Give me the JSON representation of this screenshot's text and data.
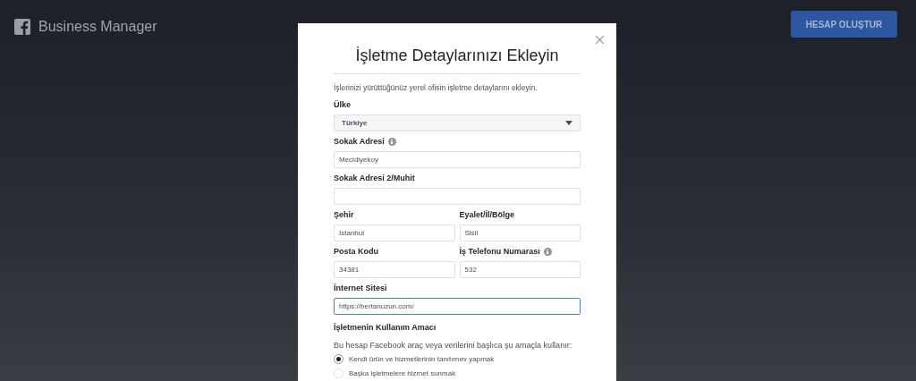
{
  "header": {
    "brand": "Business Manager",
    "create_button": "HESAP OLUŞTUR"
  },
  "modal": {
    "title": "İşletme Detaylarınızı Ekleyin",
    "intro": "İşlerinizi yürüttüğünüz yerel ofisin işletme detaylarını ekleyin.",
    "rows": [
      [
        {
          "label": "Ülke",
          "value": "Türkiye",
          "kind": "select"
        }
      ],
      [
        {
          "label": "Sokak Adresi",
          "value": "Mecidiyekoy",
          "kind": "text",
          "info": true
        }
      ],
      [
        {
          "label": "Sokak Adresi 2/Muhit",
          "kind": "text"
        }
      ],
      [
        {
          "label": "Şehir",
          "value": "Istanbul",
          "kind": "text"
        },
        {
          "label": "Eyalet/İl/Bölge",
          "value": "Sisli",
          "kind": "text"
        }
      ],
      [
        {
          "label": "Posta Kodu",
          "value": "34381",
          "kind": "text"
        },
        {
          "label": "İş Telefonu Numarası",
          "value": "532",
          "kind": "text",
          "info": true
        }
      ],
      [
        {
          "label": "İnternet Sitesi",
          "value": "https://bertanuzun.com/",
          "kind": "text",
          "focused": true
        }
      ]
    ],
    "purpose": {
      "title": "İşletmenin Kullanım Amacı",
      "question": "Bu hesap Facebook araç veya verilerini başlıca şu amaçla kullanır:",
      "options": [
        {
          "label": "Kendi ürün ve hizmetlerinin tanıtımını yapmak",
          "selected": true
        },
        {
          "label": "Başka işletmelere hizmet sunmak",
          "selected": false
        }
      ]
    }
  }
}
